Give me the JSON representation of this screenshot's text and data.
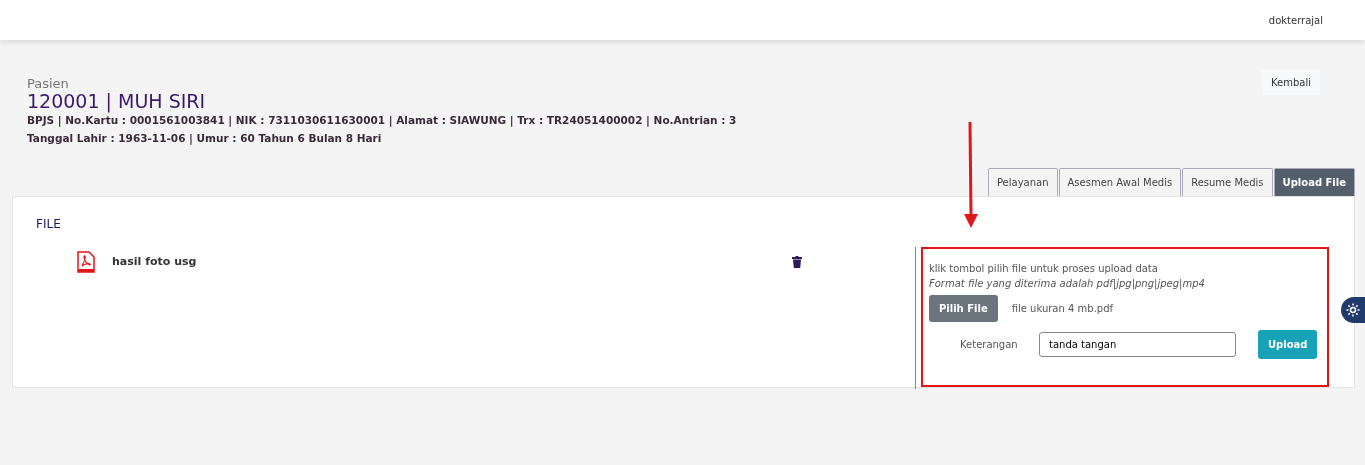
{
  "topbar": {
    "user": "dokterrajal"
  },
  "patient": {
    "label": "Pasien",
    "title": "120001 | MUH SIRI",
    "line_1": "BPJS | No.Kartu : 0001561003841 | NIK : 7311030611630001 | Alamat : SIAWUNG | Trx : TR24051400002 | No.Antrian : 3",
    "line_2": "Tanggal Lahir : 1963-11-06 | Umur : 60 Tahun 6 Bulan 8 Hari"
  },
  "back_button": "Kembali",
  "tabs": [
    {
      "label": "Pelayanan",
      "selected": false
    },
    {
      "label": "Asesmen Awal Medis",
      "selected": false
    },
    {
      "label": "Resume Medis",
      "selected": false
    },
    {
      "label": "Upload File",
      "selected": true
    }
  ],
  "section_title": "FILE",
  "files": [
    {
      "name": "hasil foto usg"
    }
  ],
  "upload": {
    "instruction": "klik tombol pilih file untuk proses upload data",
    "format_note": "Format file yang diterima adalah pdf|jpg|png|jpeg|mp4",
    "choose_button": "Pilih File",
    "chosen_file": "file ukuran 4 mb.pdf",
    "note_label": "Keterangan",
    "note_value": "tanda tangan",
    "upload_button": "Upload"
  }
}
